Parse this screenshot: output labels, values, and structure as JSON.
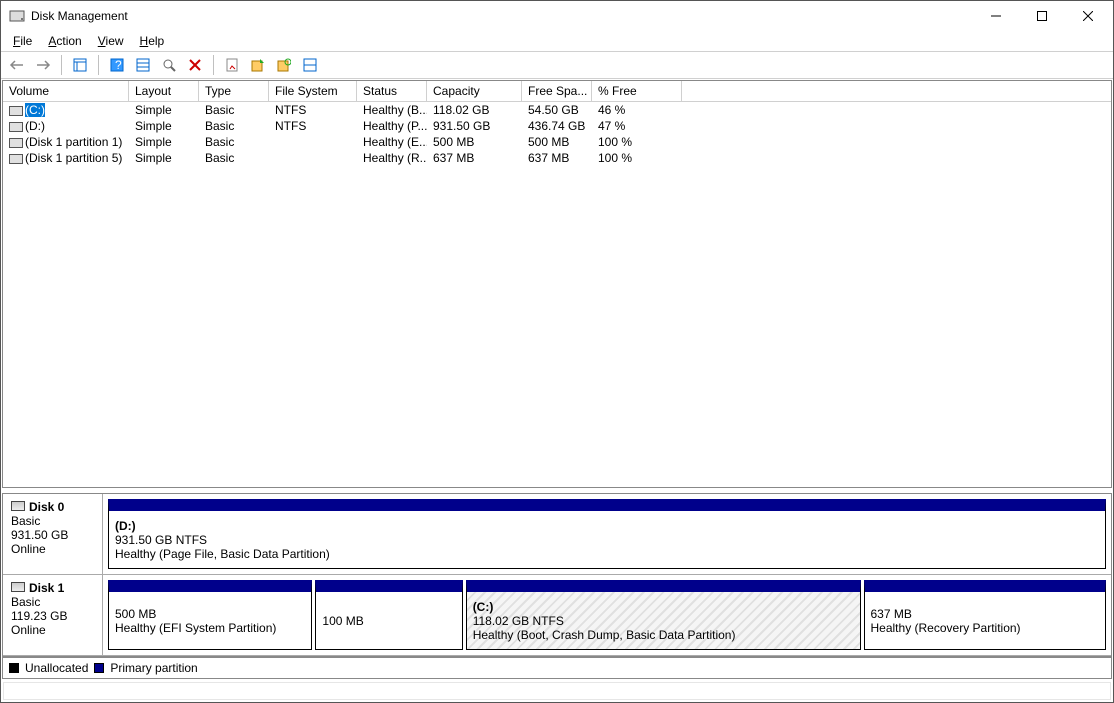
{
  "window_title": "Disk Management",
  "menu": {
    "file": "File",
    "action": "Action",
    "view": "View",
    "help": "Help"
  },
  "headers": {
    "volume": "Volume",
    "layout": "Layout",
    "type": "Type",
    "fs": "File System",
    "status": "Status",
    "cap": "Capacity",
    "free": "Free Spa...",
    "pct": "% Free"
  },
  "volumes": [
    {
      "name": "(C:)",
      "layout": "Simple",
      "type": "Basic",
      "fs": "NTFS",
      "status": "Healthy (B...",
      "cap": "118.02 GB",
      "free": "54.50 GB",
      "pct": "46 %",
      "selected": true
    },
    {
      "name": "(D:)",
      "layout": "Simple",
      "type": "Basic",
      "fs": "NTFS",
      "status": "Healthy (P...",
      "cap": "931.50 GB",
      "free": "436.74 GB",
      "pct": "47 %"
    },
    {
      "name": "(Disk 1 partition 1)",
      "layout": "Simple",
      "type": "Basic",
      "fs": "",
      "status": "Healthy (E...",
      "cap": "500 MB",
      "free": "500 MB",
      "pct": "100 %"
    },
    {
      "name": "(Disk 1 partition 5)",
      "layout": "Simple",
      "type": "Basic",
      "fs": "",
      "status": "Healthy (R...",
      "cap": "637 MB",
      "free": "637 MB",
      "pct": "100 %"
    }
  ],
  "disks": [
    {
      "name": "Disk 0",
      "type": "Basic",
      "size": "931.50 GB",
      "status": "Online",
      "parts": [
        {
          "name": "(D:)",
          "size": "931.50 GB NTFS",
          "desc": "Healthy (Page File, Basic Data Partition)",
          "flex": 100
        }
      ]
    },
    {
      "name": "Disk 1",
      "type": "Basic",
      "size": "119.23 GB",
      "status": "Online",
      "parts": [
        {
          "name": "",
          "size": "500 MB",
          "desc": "Healthy (EFI System Partition)",
          "flex": 20
        },
        {
          "name": "",
          "size": "100 MB",
          "desc": "",
          "flex": 14
        },
        {
          "name": "(C:)",
          "size": "118.02 GB NTFS",
          "desc": "Healthy (Boot, Crash Dump, Basic Data Partition)",
          "flex": 40,
          "hatched": true
        },
        {
          "name": "",
          "size": "637 MB",
          "desc": "Healthy (Recovery Partition)",
          "flex": 24
        }
      ]
    }
  ],
  "legend": {
    "unallocated": "Unallocated",
    "primary": "Primary partition"
  }
}
